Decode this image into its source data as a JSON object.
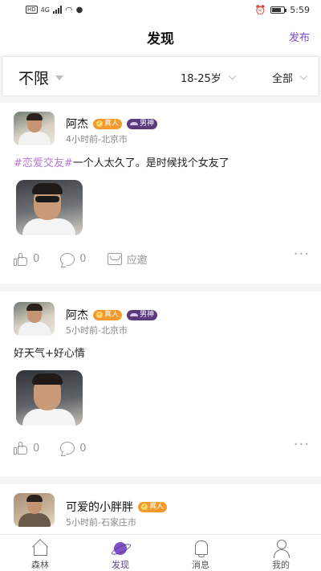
{
  "status_bar": {
    "hd_label": "HD",
    "net_label": "4G",
    "time": "5:59"
  },
  "header": {
    "title": "发现",
    "publish_label": "发布"
  },
  "filters": {
    "location": "不限",
    "age": "18-25岁",
    "category": "全部"
  },
  "posts": [
    {
      "name": "阿杰",
      "badges": [
        "真人",
        "男神"
      ],
      "meta": "4小时前-北京市",
      "tag": "#恋爱交友#",
      "text": "一个人太久了。是时候找个女友了",
      "likes": "0",
      "comments": "0",
      "invite_label": "应邀"
    },
    {
      "name": "阿杰",
      "badges": [
        "真人",
        "男神"
      ],
      "meta": "5小时前-北京市",
      "text": "好天气+好心情",
      "likes": "0",
      "comments": "0"
    },
    {
      "name": "可爱的小胖胖",
      "badges": [
        "真人"
      ],
      "meta": "5小时前-石家庄市"
    }
  ],
  "more_label": "···",
  "tabbar": [
    {
      "label": "森林",
      "icon": "house-icon"
    },
    {
      "label": "发现",
      "icon": "planet-icon"
    },
    {
      "label": "消息",
      "icon": "bell-icon"
    },
    {
      "label": "我的",
      "icon": "user-icon"
    }
  ],
  "colors": {
    "accent": "#7b4bc9",
    "tag": "#b57ad6",
    "badge_real": "#f39a2e",
    "badge_male": "#5a3a7a"
  }
}
